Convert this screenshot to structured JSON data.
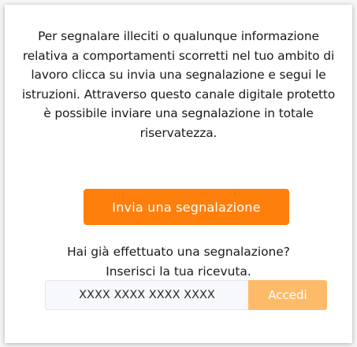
{
  "report": {
    "intro_text": "Per segnalare illeciti o qualunque informazione relativa a comportamenti scorretti nel tuo ambito di lavoro clicca su invia una segnalazione e segui le istruzioni. Attraverso questo canale digitale protetto è possibile inviare una segnalazione in totale riservatezza.",
    "button_label": "Invia una segnalazione"
  },
  "receipt": {
    "prompt_line1": "Hai già effettuato una segnalazione?",
    "prompt_line2": "Inserisci la tua ricevuta.",
    "input_placeholder": "XXXX XXXX XXXX XXXX",
    "input_value": "",
    "button_label": "Accedi"
  },
  "colors": {
    "primary_button": "#ff7f0d",
    "secondary_button": "#fdbb69",
    "input_background": "#f7f8fb",
    "text": "#1a1a1a"
  }
}
